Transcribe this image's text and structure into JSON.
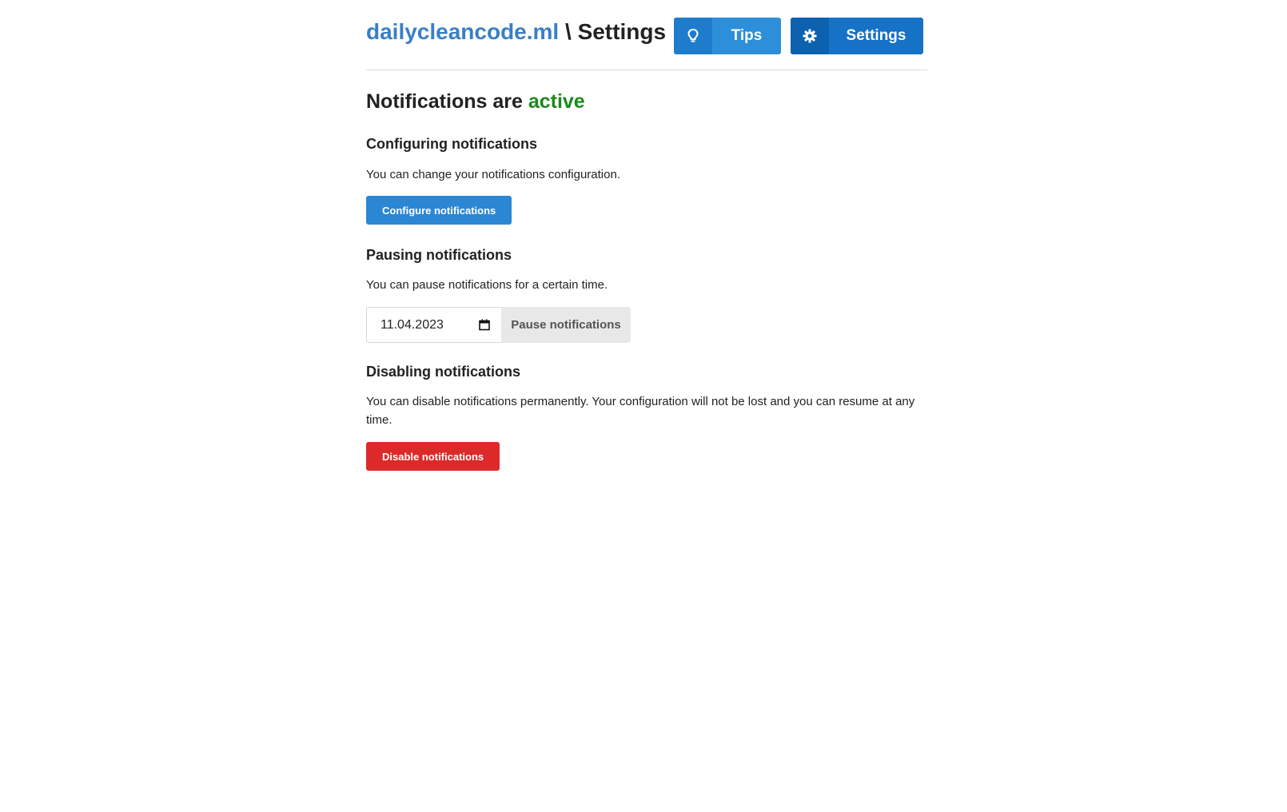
{
  "header": {
    "site_name": "dailycleancode.ml",
    "separator": " \\ ",
    "page_name": "Settings",
    "nav": {
      "tips_label": "Tips",
      "tips_icon": "lightbulb-icon",
      "settings_label": "Settings",
      "settings_icon": "gear-icon"
    }
  },
  "status": {
    "prefix": "Notifications are ",
    "state": "active",
    "state_color": "#1b8a1b"
  },
  "sections": {
    "configure": {
      "heading": "Configuring notifications",
      "text": "You can change your notifications configuration.",
      "button": "Configure notifications"
    },
    "pause": {
      "heading": "Pausing notifications",
      "text": "You can pause notifications for a certain time.",
      "date_value": "11.04.2023",
      "date_icon": "calendar-icon",
      "button": "Pause notifications"
    },
    "disable": {
      "heading": "Disabling notifications",
      "text": "You can disable notifications permanently. Your configuration will not be lost and you can resume at any time.",
      "button": "Disable notifications"
    }
  },
  "colors": {
    "brand_blue": "#3a7fc6",
    "primary_button": "#2b87d3",
    "danger_button": "#dc2a2a"
  }
}
